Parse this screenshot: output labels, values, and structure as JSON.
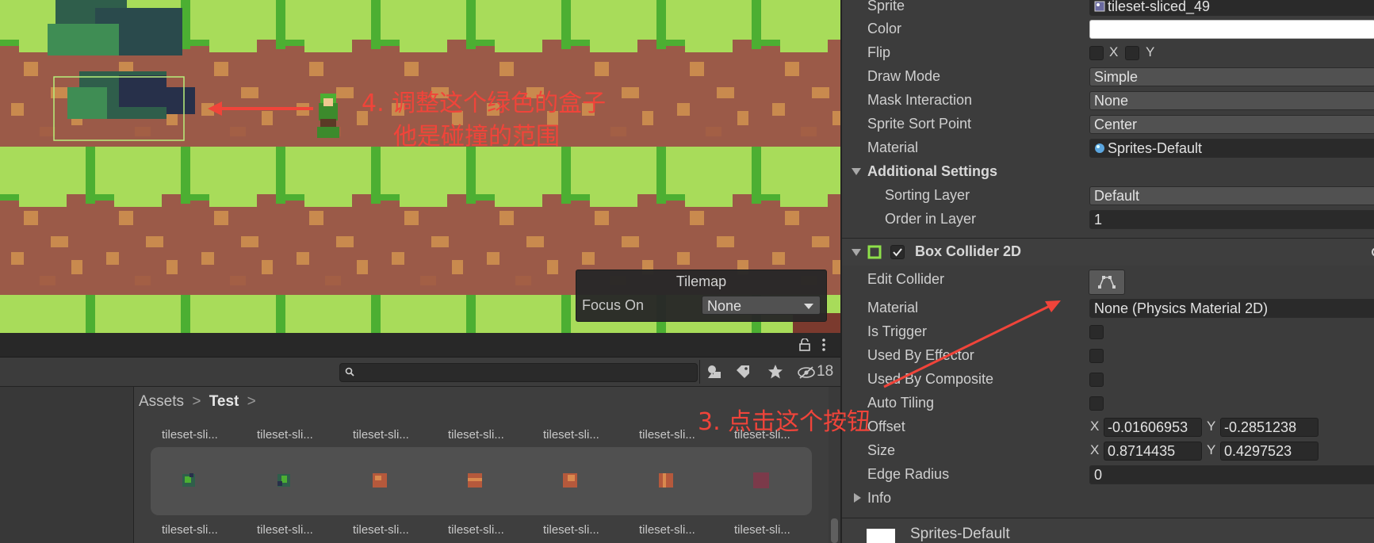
{
  "scene": {
    "annotation_4": {
      "line1": "4. 调整这个绿色的盒子",
      "line2": "他是碰撞的范围"
    },
    "annotation_3": "3. 点击这个按钮",
    "colors": {
      "grass_light": "#a8dc5a",
      "grass_dark": "#4caf32",
      "dirt": "#9b5a48",
      "dirt_spot": "#c98a4e",
      "annotation": "#f0443a"
    }
  },
  "tilemap_overlay": {
    "title": "Tilemap",
    "focus_label": "Focus On",
    "focus_value": "None"
  },
  "project": {
    "search_placeholder": "",
    "hidden_count": "18",
    "breadcrumb": {
      "root": "Assets",
      "sep": ">",
      "folder": "Test",
      "trail": ">"
    },
    "top_row": [
      "tileset-sli...",
      "tileset-sli...",
      "tileset-sli...",
      "tileset-sli...",
      "tileset-sli...",
      "tileset-sli...",
      "tileset-sli..."
    ],
    "bottom_row": [
      "tileset-sli...",
      "tileset-sli...",
      "tileset-sli...",
      "tileset-sli...",
      "tileset-sli...",
      "tileset-sli...",
      "tileset-sli..."
    ],
    "toolbar_icons": [
      "filter-by-type-icon",
      "filter-by-label-icon",
      "favorite-star-icon",
      "hidden-packages-icon"
    ]
  },
  "inspector": {
    "sprite": {
      "label": "Sprite",
      "value": "tileset-sliced_49"
    },
    "color": {
      "label": "Color",
      "value": "#ffffff"
    },
    "flip": {
      "label": "Flip",
      "x": "X",
      "y": "Y"
    },
    "draw_mode": {
      "label": "Draw Mode",
      "value": "Simple"
    },
    "mask_interaction": {
      "label": "Mask Interaction",
      "value": "None"
    },
    "sprite_sort_point": {
      "label": "Sprite Sort Point",
      "value": "Center"
    },
    "material": {
      "label": "Material",
      "value": "Sprites-Default"
    },
    "additional_settings": {
      "label": "Additional Settings"
    },
    "sorting_layer": {
      "label": "Sorting Layer",
      "value": "Default"
    },
    "order_in_layer": {
      "label": "Order in Layer",
      "value": "1"
    },
    "box_collider": {
      "title": "Box Collider 2D",
      "edit_collider": "Edit Collider",
      "material_label": "Material",
      "material_value": "None (Physics Material 2D)",
      "is_trigger": "Is Trigger",
      "used_by_effector": "Used By Effector",
      "used_by_composite": "Used By Composite",
      "auto_tiling": "Auto Tiling",
      "offset": {
        "label": "Offset",
        "x_label": "X",
        "x": "-0.01606953",
        "y_label": "Y",
        "y": "-0.2851238"
      },
      "size": {
        "label": "Size",
        "x_label": "X",
        "x": "0.8714435",
        "y_label": "Y",
        "y": "0.4297523"
      },
      "edge_radius": {
        "label": "Edge Radius",
        "value": "0"
      },
      "info": "Info"
    },
    "material_footer": "Sprites-Default"
  }
}
